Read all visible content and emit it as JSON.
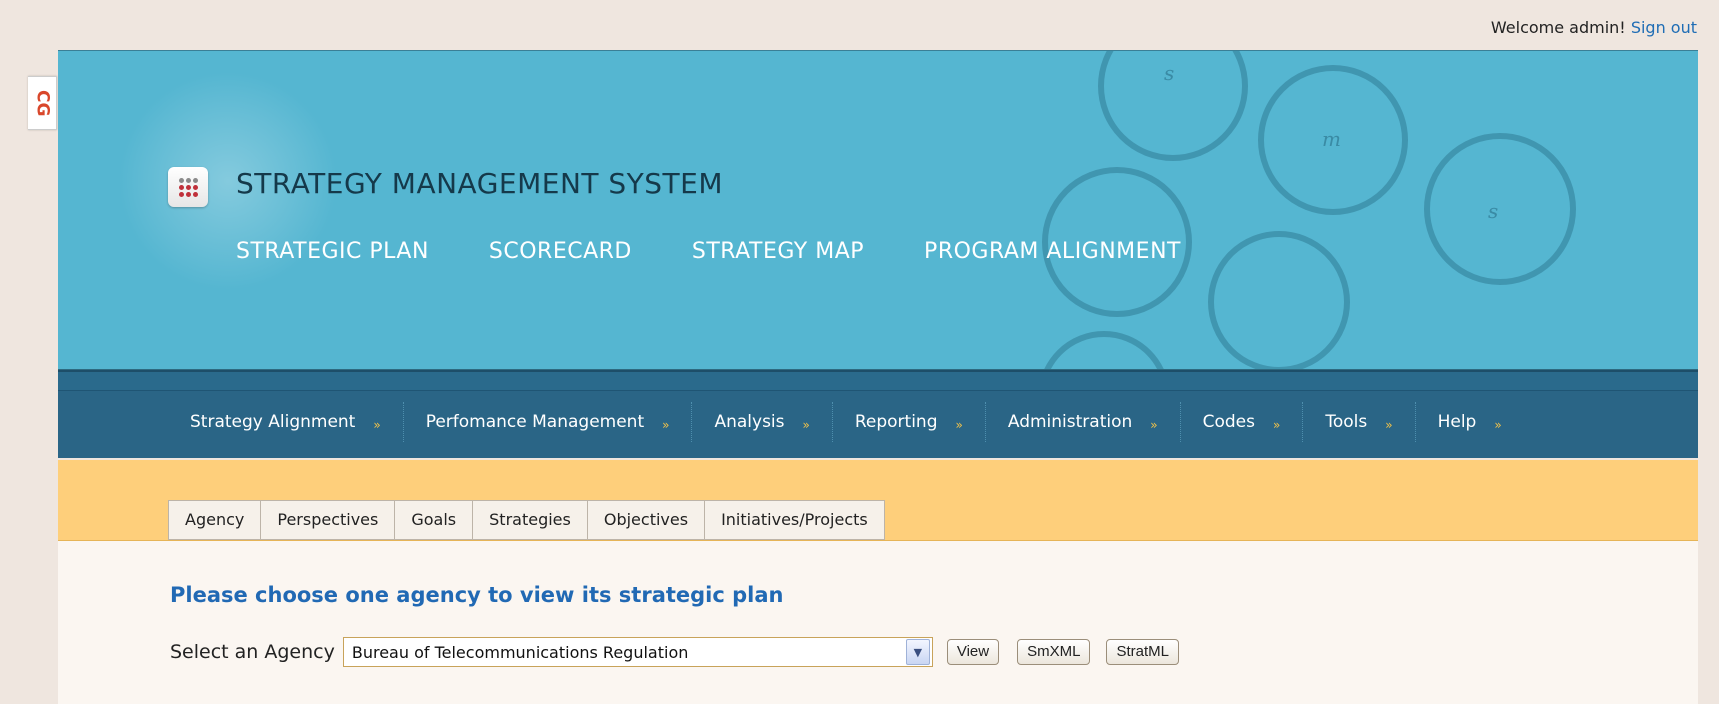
{
  "header": {
    "welcome_text": "Welcome admin!",
    "signout_label": "Sign out"
  },
  "side_tab": {
    "glyph": "CG"
  },
  "banner": {
    "title": "STRATEGY MANAGEMENT SYSTEM",
    "nav": [
      "STRATEGIC PLAN",
      "SCORECARD",
      "STRATEGY MAP",
      "PROGRAM ALIGNMENT"
    ],
    "ring_letters": [
      "s",
      "m",
      "s"
    ]
  },
  "menu": {
    "items": [
      "Strategy Alignment",
      "Perfomance Management",
      "Analysis",
      "Reporting",
      "Administration",
      "Codes",
      "Tools",
      "Help"
    ],
    "caret": "»"
  },
  "tabs": [
    "Agency",
    "Perspectives",
    "Goals",
    "Strategies",
    "Objectives",
    "Initiatives/Projects"
  ],
  "main": {
    "heading": "Please choose one agency to view its strategic plan",
    "select_label": "Select an Agency",
    "selected_agency": "Bureau of Telecommunications Regulation",
    "buttons": {
      "view": "View",
      "smxml": "SmXML",
      "stratml": "StratML"
    }
  },
  "colors": {
    "banner": "#55b6d1",
    "menubar": "#2a6586",
    "subbar": "#fecf7b",
    "heading": "#2169b4",
    "link": "#1f6db5"
  }
}
